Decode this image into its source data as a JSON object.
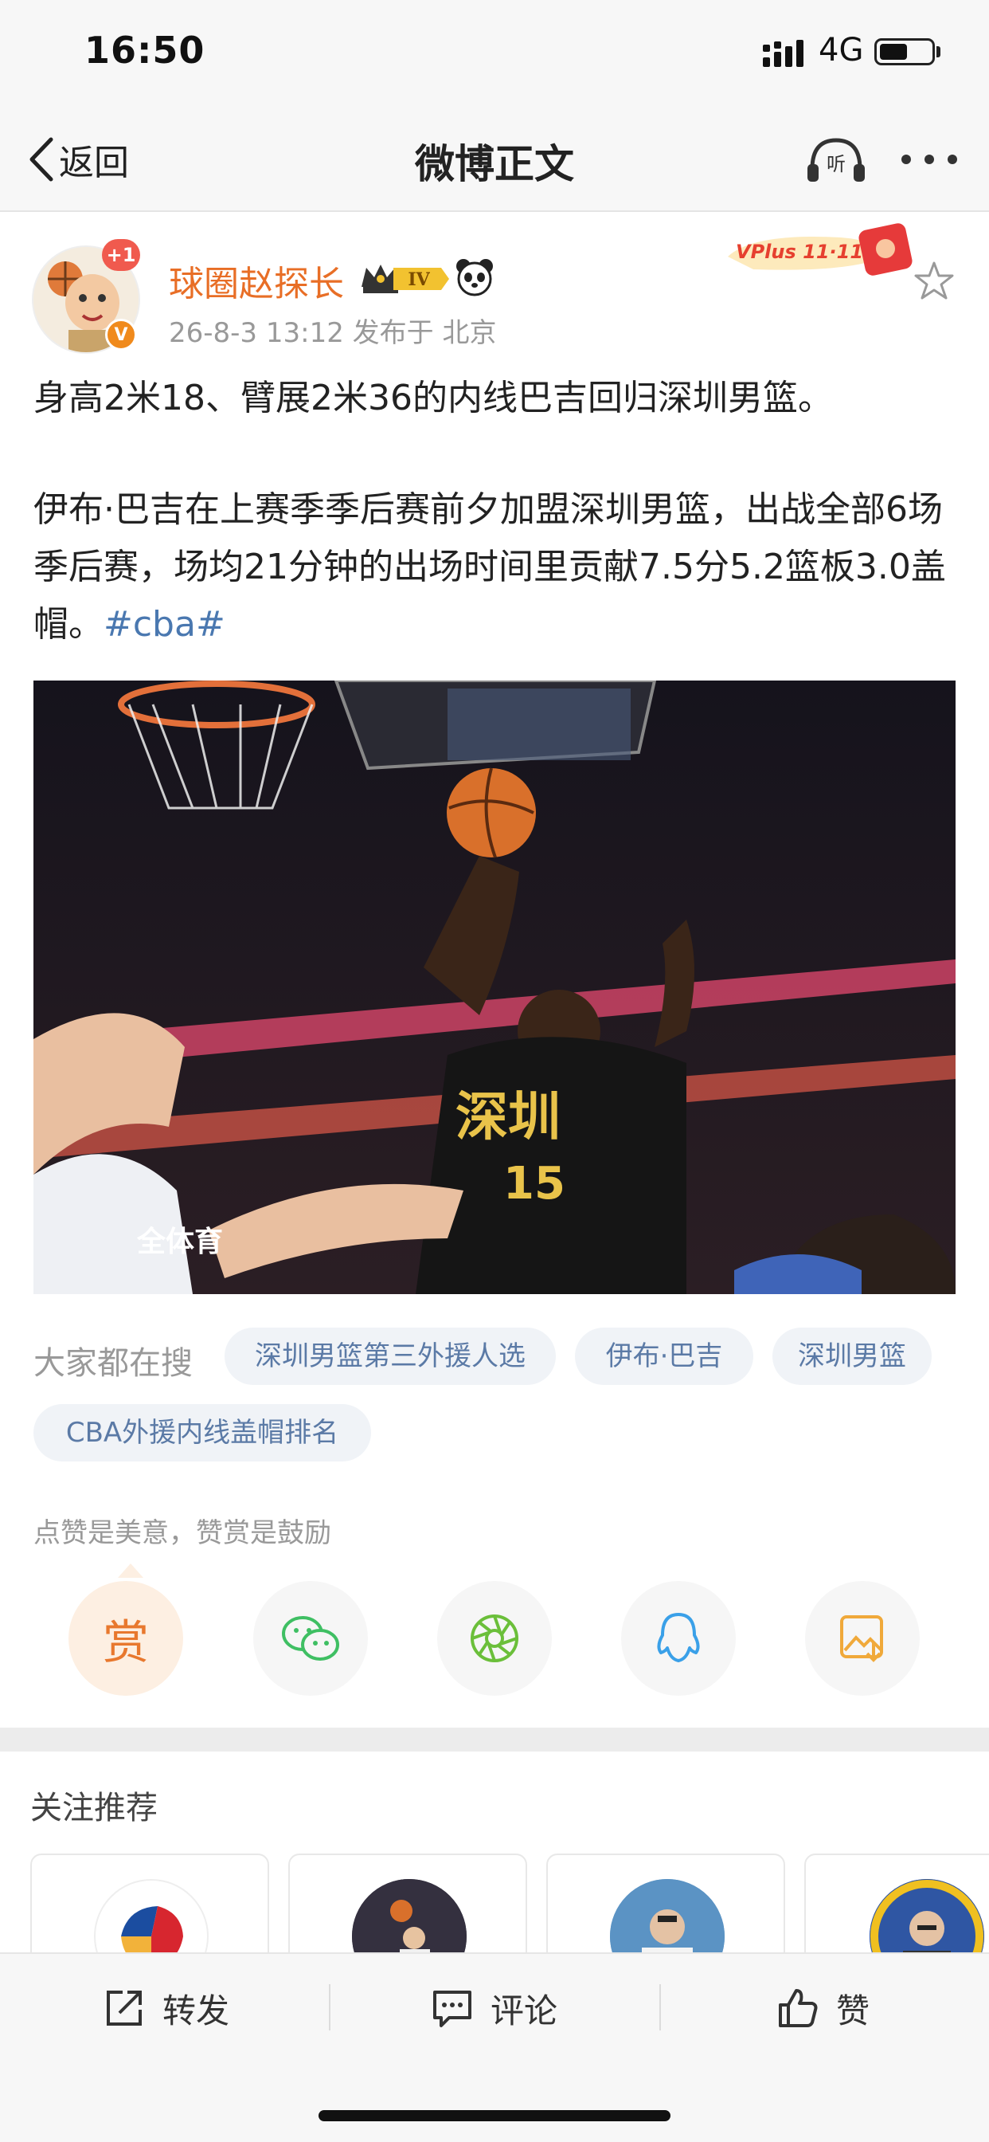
{
  "status_bar": {
    "time": "16:50",
    "network": "4G"
  },
  "nav": {
    "back_label": "返回",
    "title": "微博正文"
  },
  "author": {
    "name": "球圈赵探长",
    "plus_badge": "+1",
    "verified_badge": "V",
    "level_badge": "IV",
    "promo_badge": "VPlus 11·11",
    "meta": "26-8-3 13:12  发布于 北京"
  },
  "post": {
    "paragraph1": "身高2米18、臂展2米36的内线巴吉回归深圳男篮。",
    "paragraph2": "伊布·巴吉在上赛季季后赛前夕加盟深圳男篮，出战全部6场季后赛，场均21分钟的出场时间里贡献7.5分5.2篮板3.0盖帽。",
    "hashtag": "#cba#",
    "image_watermark": "全体育",
    "jersey_text": "深圳",
    "jersey_number": "15"
  },
  "search": {
    "label": "大家都在搜",
    "tags": [
      "深圳男篮第三外援人选",
      "伊布·巴吉",
      "深圳男篮",
      "CBA外援内线盖帽排名"
    ]
  },
  "reward": {
    "text": "点赞是美意，赞赏是鼓励",
    "reward_label": "赏",
    "share_icons": [
      "wechat-icon",
      "moments-icon",
      "qq-icon",
      "save-image-icon"
    ]
  },
  "follow": {
    "title": "关注推荐"
  },
  "toolbar": {
    "repost": "转发",
    "comment": "评论",
    "like": "赞"
  },
  "colors": {
    "accent": "#e86e26",
    "link": "#4a78b0",
    "chip_text": "#5b7aa6"
  }
}
